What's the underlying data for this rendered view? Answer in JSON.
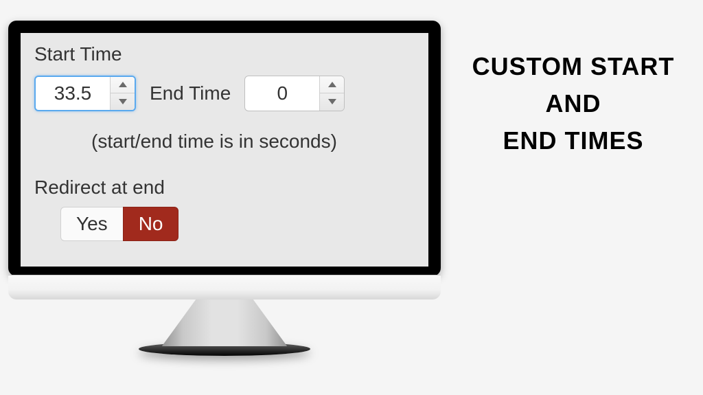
{
  "headline": {
    "line1": "Custom Start and",
    "line2": "End Times"
  },
  "form": {
    "start_label": "Start Time",
    "end_label": "End Time",
    "start_value": "33.5",
    "end_value": "0",
    "help_note": "(start/end time is in seconds)",
    "redirect_label": "Redirect at end",
    "redirect_yes": "Yes",
    "redirect_no": "No",
    "redirect_selected": "no"
  }
}
